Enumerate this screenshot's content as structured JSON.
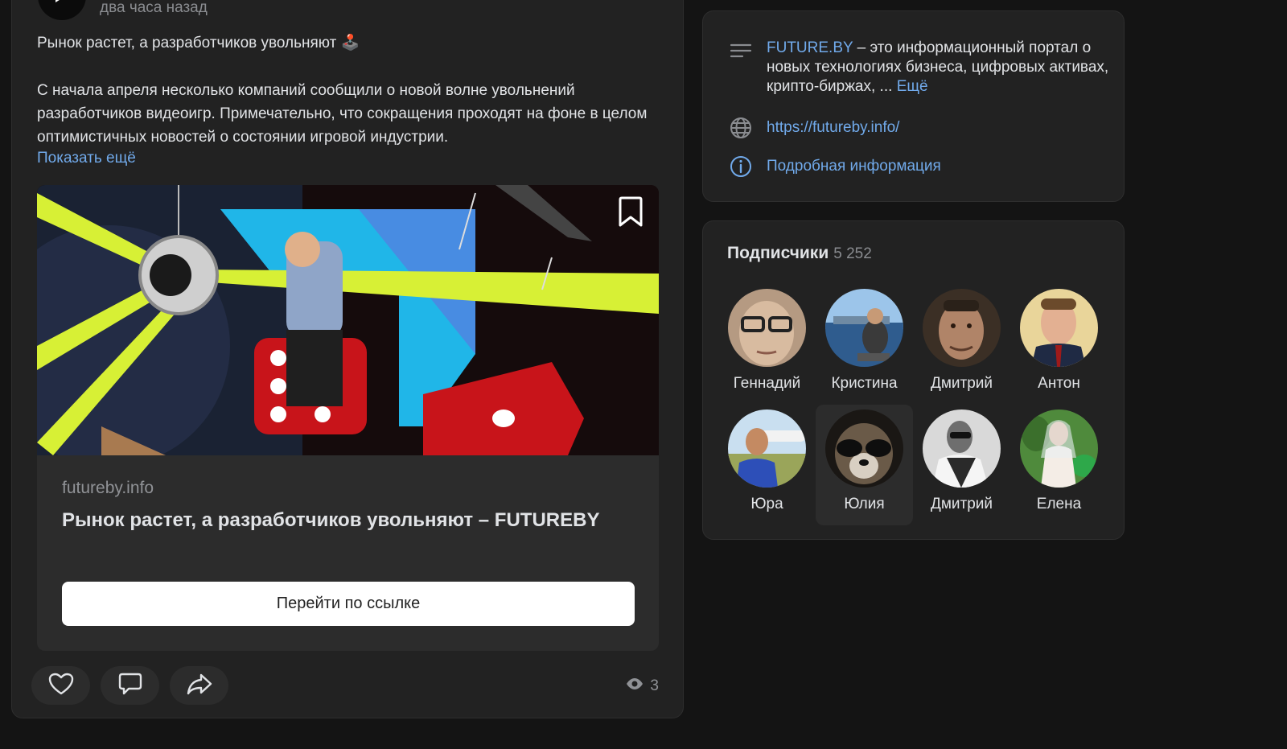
{
  "post": {
    "time": "два часа назад",
    "title": "Рынок растет, а разработчиков увольняют 🕹️",
    "text": "С начала апреля несколько компаний сообщили о новой волне увольнений разработчиков видеоигр. Примечательно, что сокращения проходят на фоне в целом оптимистичных новостей о состоянии игровой индустрии.",
    "show_more": "Показать ещё",
    "card": {
      "domain": "futureby.info",
      "title": "Рынок растет, а разработчиков увольняют – FUTUREBY",
      "button": "Перейти по ссылке"
    },
    "views": "3",
    "icons": [
      "like-icon",
      "comment-icon",
      "share-icon",
      "eye-icon",
      "bookmark-icon"
    ]
  },
  "info": {
    "brand": "FUTURE.BY",
    "description": " – это информационный портал о новых технологиях бизнеса, цифровых активах, крипто-биржах, ... ",
    "more": "Ещё",
    "url": "https://futureby.info/",
    "details": "Подробная информация"
  },
  "subscribers": {
    "title": "Подписчики",
    "count": "5 252",
    "items": [
      {
        "name": "Геннадий"
      },
      {
        "name": "Кристина"
      },
      {
        "name": "Дмитрий"
      },
      {
        "name": "Антон"
      },
      {
        "name": "Юра"
      },
      {
        "name": "Юлия"
      },
      {
        "name": "Дмитрий"
      },
      {
        "name": "Елена"
      }
    ]
  },
  "colors": {
    "accent": "#71aaeb",
    "background": "#141414",
    "card": "#222222"
  }
}
